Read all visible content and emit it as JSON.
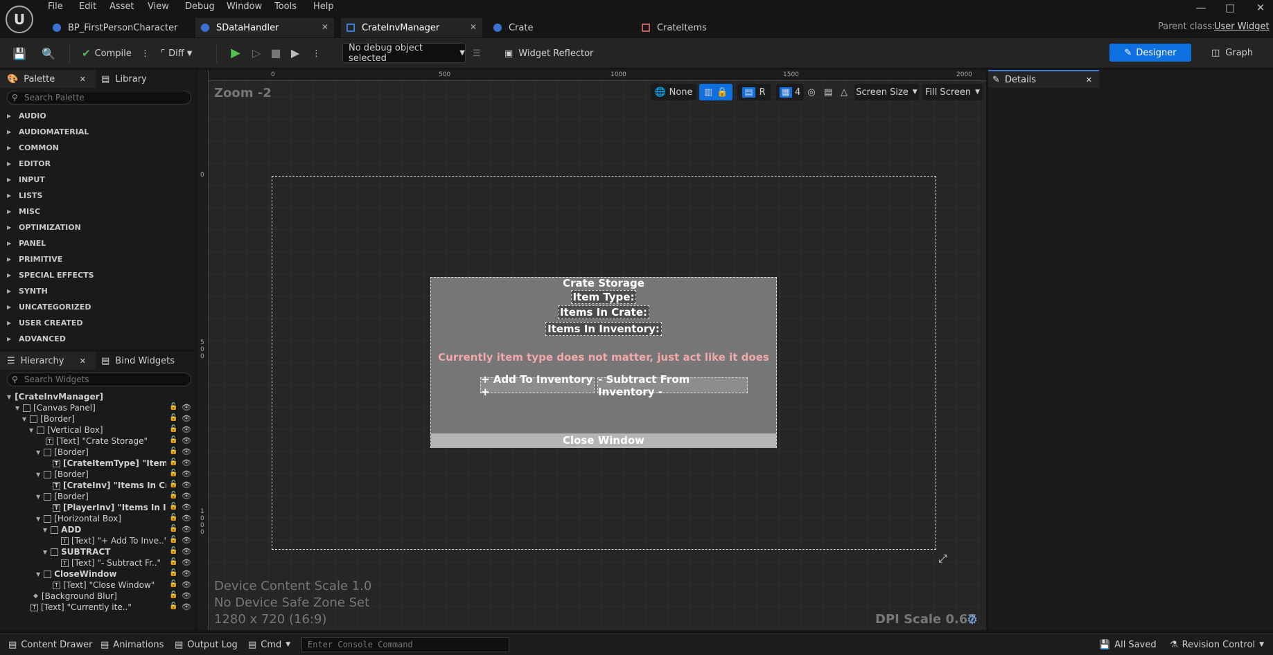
{
  "menu": [
    "File",
    "Edit",
    "Asset",
    "View",
    "Debug",
    "Window",
    "Tools",
    "Help"
  ],
  "tabs": [
    {
      "label": "BP_FirstPersonCharacter"
    },
    {
      "label": "SDataHandler"
    },
    {
      "label": "CrateInvManager"
    },
    {
      "label": "Crate"
    },
    {
      "label": "CrateItems"
    }
  ],
  "parent_class": {
    "label": "Parent class:",
    "value": "User Widget"
  },
  "toolbar": {
    "compile_label": "Compile",
    "diff_label": "Diff",
    "debug_object": "No debug object selected",
    "widget_reflector": "Widget Reflector",
    "designer_label": "Designer",
    "graph_label": "Graph"
  },
  "palette": {
    "tab_label": "Palette",
    "library_label": "Library",
    "search_placeholder": "Search Palette",
    "categories": [
      "AUDIO",
      "AUDIOMATERIAL",
      "COMMON",
      "EDITOR",
      "INPUT",
      "LISTS",
      "MISC",
      "OPTIMIZATION",
      "PANEL",
      "PRIMITIVE",
      "SPECIAL EFFECTS",
      "SYNTH",
      "UNCATEGORIZED",
      "USER CREATED",
      "ADVANCED"
    ]
  },
  "hierarchy": {
    "tab_label": "Hierarchy",
    "bind_label": "Bind Widgets",
    "search_placeholder": "Search Widgets",
    "items": [
      "[CrateInvManager]",
      "[Canvas Panel]",
      "[Border]",
      "[Vertical Box]",
      "[Text] \"Crate Storage\"",
      "[Border]",
      "[CrateItemType] \"Item Typ",
      "[Border]",
      "[CrateInv] \"Items In Crat..",
      "[Border]",
      "[PlayerInv] \"Items In Inve..",
      "[Horizontal Box]",
      "ADD",
      "[Text] \"+ Add To Inve..\"",
      "SUBTRACT",
      "[Text] \"- Subtract Fr..\"",
      "CloseWindow",
      "[Text] \"Close Window\"",
      "[Background Blur]",
      "[Text] \"Currently ite..\""
    ]
  },
  "canvas": {
    "zoom": "Zoom -2",
    "ruler_top": [
      "0",
      "500",
      "1000",
      "1500",
      "2000"
    ],
    "ruler_left": [
      "0",
      "5\n0\n0",
      "1\n0\n0\n0"
    ],
    "locale": "None",
    "r_label": "R",
    "grid_snap": "4",
    "screen_size": "Screen Size",
    "fill_screen": "Fill Screen",
    "device_scale": "Device Content Scale 1.0",
    "safe_zone": "No Device Safe Zone Set",
    "resolution": "1280 x 720 (16:9)",
    "dpi_scale": "DPI Scale 0.67"
  },
  "widget": {
    "title": "Crate Storage",
    "item_type": "Item Type:",
    "items_in_crate": "Items In Crate:",
    "items_in_inventory": "Items In Inventory:",
    "note": "Currently item type does not matter, just act like it does",
    "add_button": "+ Add To Inventory +",
    "subtract_button": "- Subtract From Inventory -",
    "close_button": "Close Window"
  },
  "details": {
    "tab_label": "Details"
  },
  "statusbar": {
    "content_drawer": "Content Drawer",
    "animations": "Animations",
    "output_log": "Output Log",
    "cmd": "Cmd",
    "console_placeholder": "Enter Console Command",
    "all_saved": "All Saved",
    "revision_control": "Revision Control"
  },
  "colors": {
    "accent": "#0e70e0",
    "note_text": "#f2a8a8",
    "widget_bg": "#767676"
  }
}
